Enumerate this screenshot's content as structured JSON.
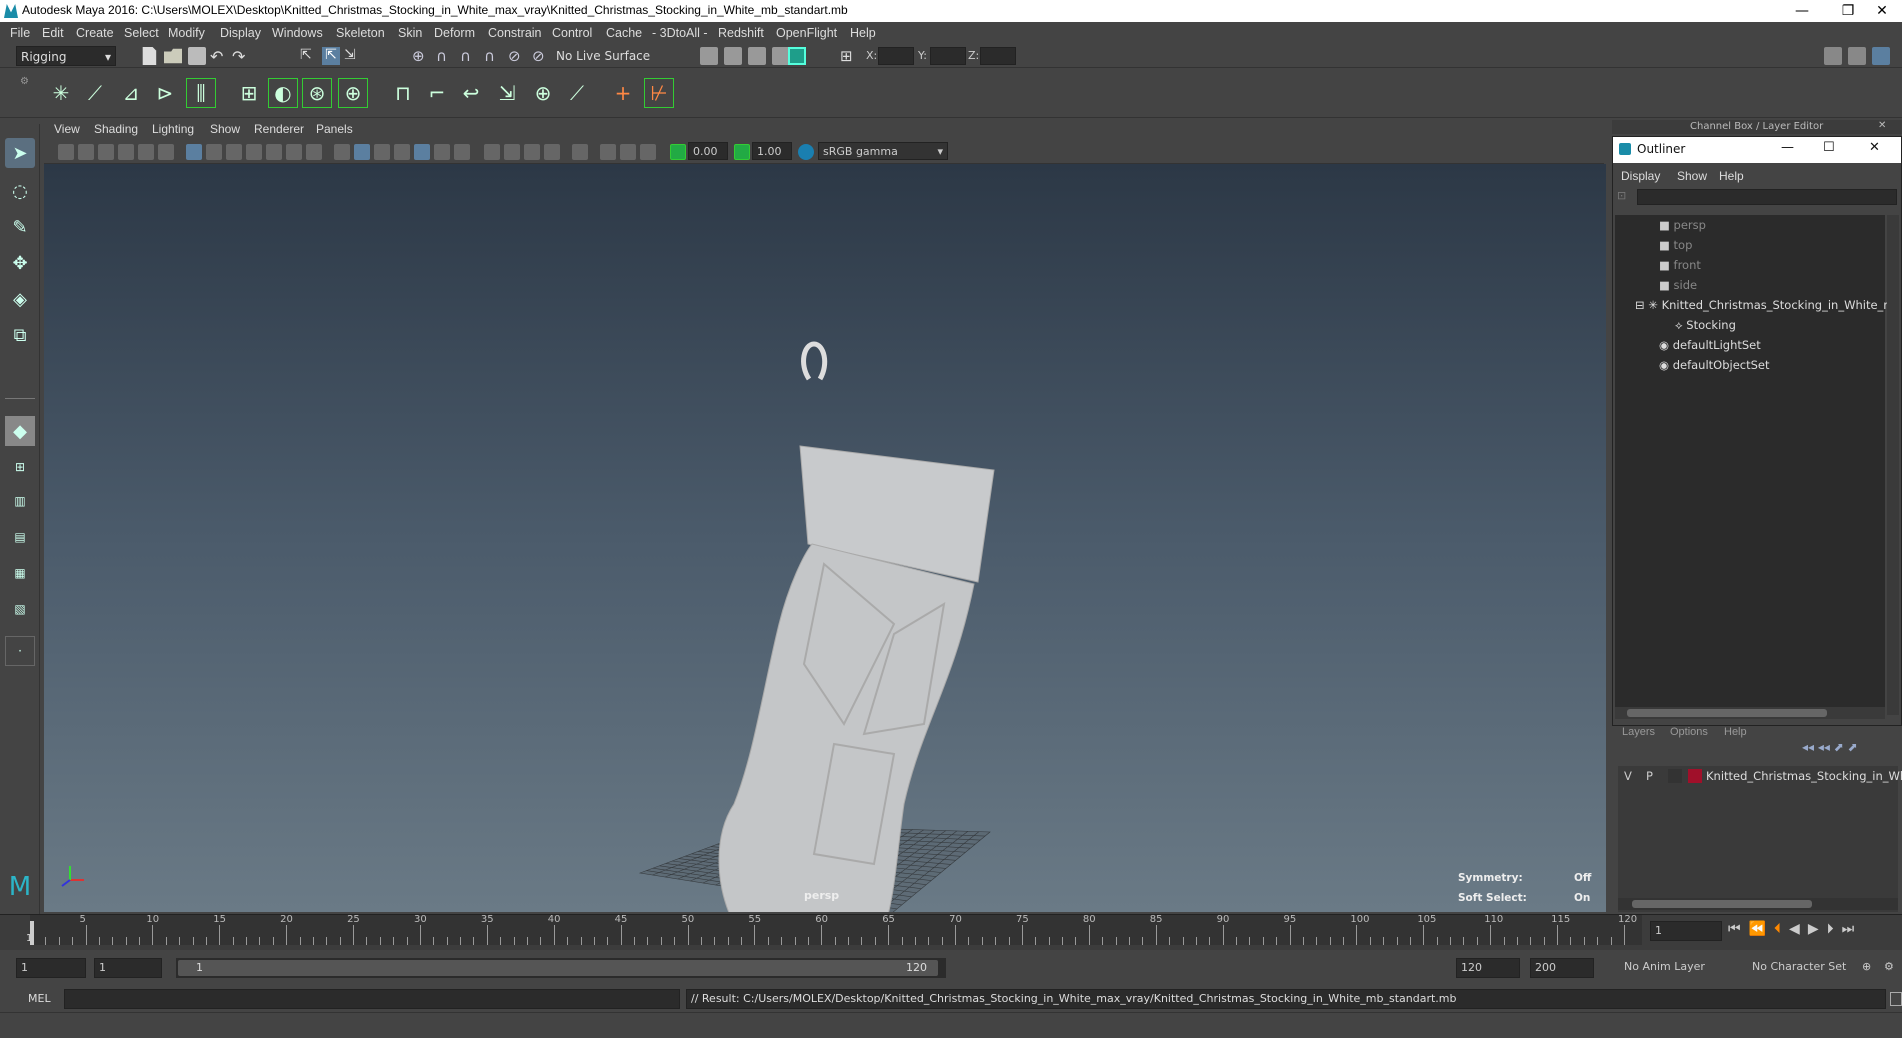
{
  "window": {
    "title": "Autodesk Maya 2016: C:\\Users\\MOLEX\\Desktop\\Knitted_Christmas_Stocking_in_White_max_vray\\Knitted_Christmas_Stocking_in_White_mb_standart.mb",
    "minimize": "—",
    "restore": "❐",
    "close": "✕"
  },
  "menubar": [
    "File",
    "Edit",
    "Create",
    "Select",
    "Modify",
    "Display",
    "Windows",
    "Skeleton",
    "Skin",
    "Deform",
    "Constrain",
    "Control",
    "Cache",
    "- 3DtoAll -",
    "Redshift",
    "OpenFlight",
    "Help"
  ],
  "status": {
    "mode": "Rigging",
    "live_surface": "No Live Surface",
    "x_label": "X:",
    "y_label": "Y:",
    "z_label": "Z:"
  },
  "panel_menu": [
    "View",
    "Shading",
    "Lighting",
    "Show",
    "Renderer",
    "Panels"
  ],
  "panel_bar": {
    "exposure": "0.00",
    "gamma": "1.00",
    "colorspace": "sRGB gamma"
  },
  "viewport": {
    "camera_label": "persp",
    "symmetry_label": "Symmetry:",
    "symmetry_value": "Off",
    "soft_select_label": "Soft Select:",
    "soft_select_value": "On"
  },
  "channel_box_title": "Channel Box / Layer Editor",
  "outliner": {
    "title": "Outliner",
    "menu": [
      "Display",
      "Show",
      "Help"
    ],
    "items": [
      {
        "label": "persp",
        "type": "camera",
        "dim": true
      },
      {
        "label": "top",
        "type": "camera",
        "dim": true
      },
      {
        "label": "front",
        "type": "camera",
        "dim": true
      },
      {
        "label": "side",
        "type": "camera",
        "dim": true
      },
      {
        "label": "Knitted_Christmas_Stocking_in_White_r",
        "type": "group",
        "dim": false
      },
      {
        "label": "Stocking",
        "type": "mesh",
        "dim": false
      },
      {
        "label": "defaultLightSet",
        "type": "set",
        "dim": false
      },
      {
        "label": "defaultObjectSet",
        "type": "set",
        "dim": false
      }
    ]
  },
  "layer_editor": {
    "menu": [
      "Layers",
      "Options",
      "Help"
    ],
    "layer": {
      "v": "V",
      "p": "P",
      "name": "Knitted_Christmas_Stocking_in_Wh",
      "color": "#a0102a"
    }
  },
  "timeline": {
    "ticks": [
      "5",
      "10",
      "15",
      "20",
      "25",
      "30",
      "35",
      "40",
      "45",
      "50",
      "55",
      "60",
      "65",
      "70",
      "75",
      "80",
      "85",
      "90",
      "95",
      "100",
      "105",
      "110",
      "115",
      "120"
    ],
    "start_label": "1",
    "current_frame": "1"
  },
  "range": {
    "start": "1",
    "start2": "1",
    "slider_start": "1",
    "slider_end": "120",
    "end": "120",
    "end2": "200",
    "anim_layer": "No Anim Layer",
    "character_set": "No Character Set"
  },
  "command": {
    "lang": "MEL",
    "result": "// Result: C:/Users/MOLEX/Desktop/Knitted_Christmas_Stocking_in_White_max_vray/Knitted_Christmas_Stocking_in_White_mb_standart.mb"
  }
}
